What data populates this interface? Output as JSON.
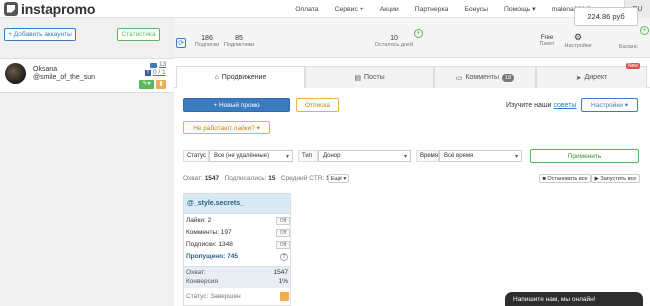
{
  "brand": {
    "name": "instapromo"
  },
  "nav": {
    "items": [
      "Оплата",
      "Сервис +",
      "Акции",
      "Партнерка",
      "Бонусы",
      "Помощь ▾",
      "malena008@yan... ▾"
    ],
    "lang": "RU"
  },
  "left": {
    "add_accounts": "+ Добавить аккаунты",
    "stats_button": "Статистика"
  },
  "stats": {
    "subscriptions_num": "186",
    "subscriptions_lbl": "Подписки",
    "followers_num": "85",
    "followers_lbl": "Подписчики",
    "days_num": "10",
    "days_lbl": "Осталось дней",
    "plan_value": "Free",
    "plan_lbl": "Пакет",
    "settings_lbl": "Настройки",
    "balance_value": "224.86 руб",
    "balance_lbl": "Баланс"
  },
  "account": {
    "name": "Oksana",
    "handle": "@smile_of_the_sun",
    "messages": "13",
    "ratio": "0 / 1"
  },
  "tabs": [
    {
      "label": "Продвижение",
      "icon": "home-icon"
    },
    {
      "label": "Посты",
      "icon": "list-icon"
    },
    {
      "label": "Комменты",
      "icon": "comment-icon",
      "badge": "18"
    },
    {
      "label": "Директ",
      "icon": "send-icon",
      "new": "New"
    }
  ],
  "toolbar": {
    "new_promo": "+ Новый промо",
    "reports": "Отписка",
    "learn_text": "Изучите наши",
    "learn_link": "советы",
    "settings": "Настройки ▾",
    "no_likes": "Не работают лайки? ▾"
  },
  "filters": {
    "status_label": "Статус",
    "status_value": "Все (не удалённые)",
    "type_label": "Тип",
    "type_value": "Донор",
    "time_label": "Время",
    "time_value": "Всё время",
    "apply": "Применить"
  },
  "summary": {
    "reach_label": "Охват:",
    "reach_value": "1547",
    "subs_label": "Подписались:",
    "subs_value": "15",
    "ctr_label": "Средний CTR:",
    "ctr_value": "1%",
    "more": "Ещё ▾",
    "stop_all": "Остановить все",
    "start_all": "Запустить все"
  },
  "card": {
    "title": "@_style.secrets_",
    "likes": "Лайки: 2",
    "comments": "Комменты: 197",
    "subs": "Подписки: 1348",
    "skipped": "Пропущено: 745",
    "reach_label": "Охват:",
    "reach_value": "1547",
    "conv_label": "Конверсия",
    "conv_value": "1%",
    "status": "Статус: Завершен",
    "off_label": "Off"
  },
  "chat": {
    "text": "Напишите нам, мы онлайн!"
  }
}
